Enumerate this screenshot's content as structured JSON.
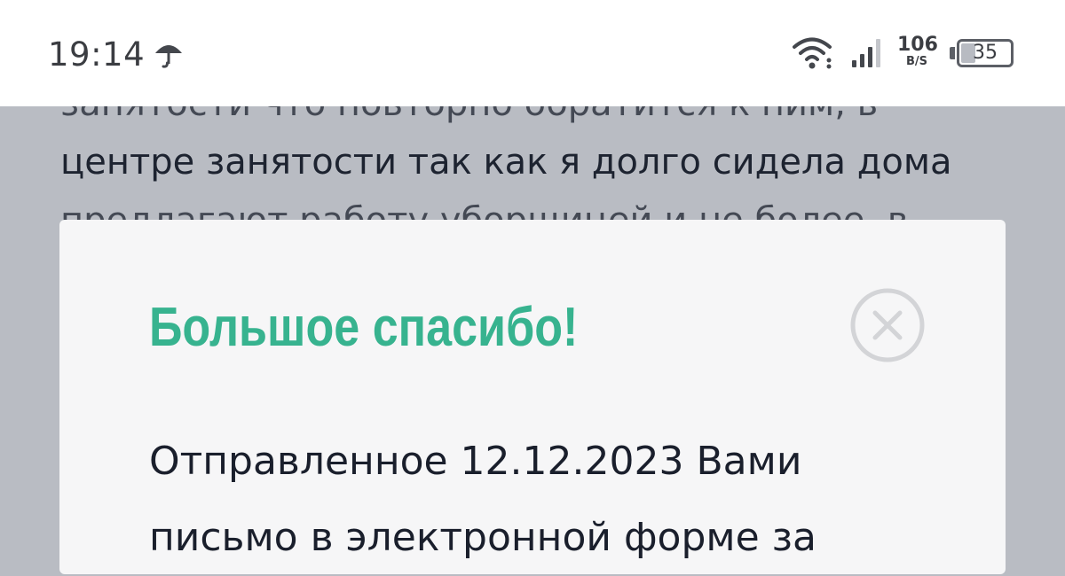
{
  "status_bar": {
    "time": "19:14",
    "network_speed": "106",
    "network_speed_unit": "B/S",
    "battery_level": "35",
    "battery_fraction": 0.35
  },
  "background_text": {
    "lines": [
      "занятости что повторно обратится к ним, в",
      "центре занятости так как я долго сидела дома",
      "предлагают работу уборщицей и не более, в"
    ]
  },
  "modal": {
    "title": "Большое спасибо!",
    "body_lines": [
      "Отправленное 12.12.2023 Вами",
      "письмо в электронной форме за"
    ],
    "accent_color": "#37b38f"
  }
}
